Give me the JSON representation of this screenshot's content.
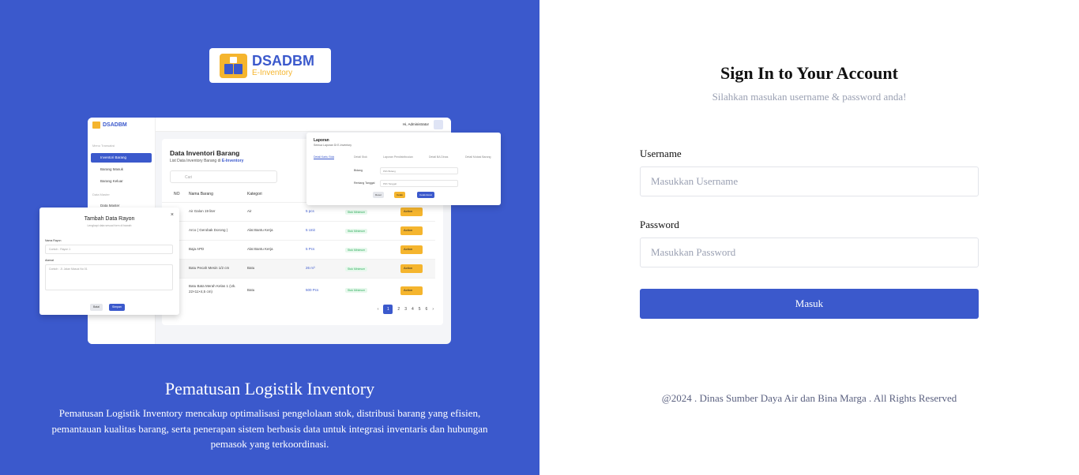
{
  "logo": {
    "name": "DSADBM",
    "tagline": "E-Inventory"
  },
  "preview": {
    "sidebar": {
      "brand": "DSADBM",
      "section_transaction": "Menu Transaksi",
      "items": [
        "Inventori Barang",
        "Barang Masuk",
        "Barang Keluar"
      ],
      "section_master": "Data Master",
      "master_item": "Data Master"
    },
    "topbar_user": "Hi, Administrator",
    "card": {
      "title": "Data Inventori Barang",
      "subtitle": "List Data Inventory Barang di",
      "subtitle_brand": "E-Inventory",
      "search_placeholder": "Cari",
      "columns": [
        "NO",
        "Nama Barang",
        "Kategori"
      ],
      "rows": [
        {
          "name": "Air Galon 19 liter",
          "category": "Air",
          "qty": "5 pcs",
          "status": "Stok Minimum",
          "action": "Action"
        },
        {
          "name": "Arco ( Gerobak Dorong )",
          "category": "Alat Bantu Kerja",
          "qty": "5 Unit",
          "status": "Stok Minimum",
          "action": "Action"
        },
        {
          "name": "Baja APD",
          "category": "Alat Bantu Kerja",
          "qty": "5 Pcs",
          "status": "Stok Minimum",
          "action": "Action"
        },
        {
          "name": "Batu Pecah Mesin 1/2 cm",
          "category": "Batu",
          "qty": "26 m³",
          "status": "Stok Minimum",
          "action": "Action"
        },
        {
          "name": "Batu Bata Merah Kelas 1 (Uk. 22×11×4,5 cm)",
          "category": "Batu",
          "qty": "500 Pcs",
          "status": "Stok Minimum",
          "action": "Action"
        }
      ],
      "pages": [
        "1",
        "2",
        "3",
        "4",
        "5",
        "6"
      ]
    },
    "report": {
      "title": "Laporan",
      "subtitle": "Semua Laporan Di E-Inventory",
      "tabs": [
        "Detail Kartu Stok",
        "Detail Stok",
        "Laporan Pendistribusian",
        "Detail BA Dinas",
        "Detail Mutasi Barang"
      ],
      "field1_label": "Bidang",
      "field1_value": "Pilih Bidang",
      "field2_label": "Rentang Tanggal",
      "field2_value": "Pilih Tanggal",
      "btn_reset": "Reset",
      "btn_print": "Cetak",
      "btn_excel": "Cetak Excel"
    },
    "modal": {
      "title": "Tambah Data Rayon",
      "subtitle": "Lengkapi data sesuai form di bawah",
      "field1_label": "Nama Rayon",
      "field1_value": "Contoh : Rayon 1",
      "field2_label": "Alamat",
      "field2_value": "Contoh : Jl. Jalan Masuk No 01",
      "btn_cancel": "Batal",
      "btn_save": "Simpan"
    }
  },
  "left": {
    "headline": "Pematusan Logistik Inventory",
    "description": "Pematusan Logistik Inventory mencakup optimalisasi pengelolaan stok, distribusi barang yang efisien, pemantauan kualitas barang, serta penerapan sistem berbasis data untuk integrasi inventaris dan hubungan pemasok yang terkoordinasi."
  },
  "right": {
    "title": "Sign In to Your Account",
    "subtitle": "Silahkan masukan username & password anda!",
    "username_label": "Username",
    "username_placeholder": "Masukkan Username",
    "password_label": "Password",
    "password_placeholder": "Masukkan Password",
    "submit_label": "Masuk",
    "footer": "@2024 . Dinas Sumber Daya Air dan Bina Marga . All Rights Reserved"
  },
  "colors": {
    "primary": "#3b59cc",
    "accent": "#f5b52e",
    "muted": "#9aa0b2"
  }
}
